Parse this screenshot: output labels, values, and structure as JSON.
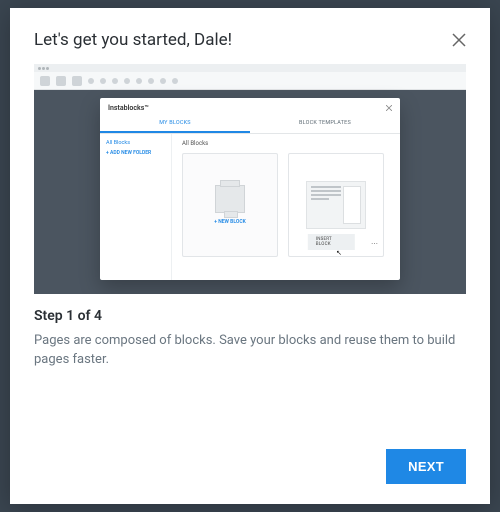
{
  "modal": {
    "title": "Let's get you started, Dale!",
    "step_label": "Step 1 of 4",
    "description": "Pages are composed of blocks. Save your blocks and reuse them to build pages faster.",
    "next_label": "NEXT"
  },
  "inner": {
    "title": "Instablocks™",
    "tab_myblocks": "MY BLOCKS",
    "tab_templates": "BLOCK TEMPLATES",
    "side_all": "All Blocks",
    "side_add": "+ ADD NEW FOLDER",
    "main_title": "All Blocks",
    "new_block": "+ NEW BLOCK",
    "insert_block": "INSERT BLOCK"
  },
  "step": {
    "current": 1,
    "total": 4
  }
}
